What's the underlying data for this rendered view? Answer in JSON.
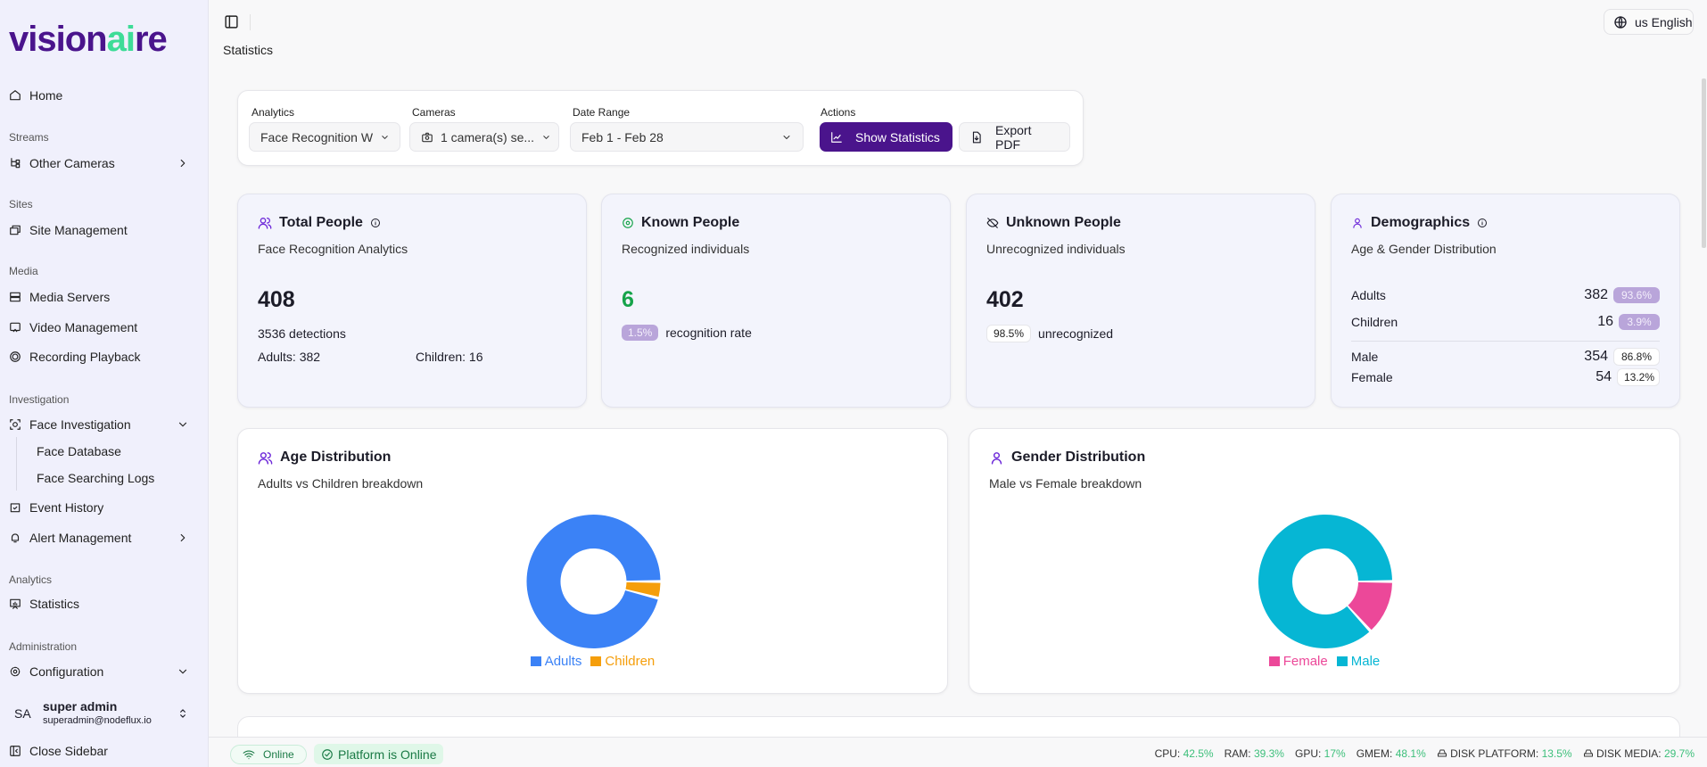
{
  "brand": {
    "logo_text_a": "visi",
    "logo_text_b": "on",
    "logo_text_c": "ai",
    "logo_text_d": "re"
  },
  "sidebar": {
    "home": "Home",
    "sections": {
      "streams": "Streams",
      "sites": "Sites",
      "media": "Media",
      "investigation": "Investigation",
      "analytics": "Analytics",
      "administration": "Administration"
    },
    "items": {
      "other_cameras": "Other Cameras",
      "site_management": "Site Management",
      "media_servers": "Media Servers",
      "video_management": "Video Management",
      "recording_playback": "Recording Playback",
      "face_investigation": "Face Investigation",
      "face_database": "Face Database",
      "face_searching_logs": "Face Searching Logs",
      "event_history": "Event History",
      "alert_management": "Alert Management",
      "statistics": "Statistics",
      "configuration": "Configuration"
    },
    "user": {
      "initials": "SA",
      "name": "super admin",
      "email": "superadmin@nodeflux.io"
    },
    "close": "Close Sidebar"
  },
  "header": {
    "breadcrumb": "Statistics",
    "language": "us English"
  },
  "filters": {
    "analytics_label": "Analytics",
    "analytics_value": "Face Recognition W",
    "cameras_label": "Cameras",
    "cameras_value": "1 camera(s) se...",
    "date_label": "Date Range",
    "date_value": "Feb 1 - Feb 28",
    "actions_label": "Actions",
    "show_statistics": "Show Statistics",
    "export_pdf": "Export PDF"
  },
  "cards": {
    "total": {
      "title": "Total People",
      "subtitle": "Face Recognition Analytics",
      "value": "408",
      "detections": "3536 detections",
      "adults": "Adults: 382",
      "children": "Children: 16"
    },
    "known": {
      "title": "Known People",
      "subtitle": "Recognized individuals",
      "value": "6",
      "rate": "1.5%",
      "rate_label": "recognition rate"
    },
    "unknown": {
      "title": "Unknown People",
      "subtitle": "Unrecognized individuals",
      "value": "402",
      "rate": "98.5%",
      "rate_label": "unrecognized"
    },
    "demographics": {
      "title": "Demographics",
      "subtitle": "Age & Gender Distribution",
      "rows": [
        {
          "label": "Adults",
          "value": "382",
          "pct": "93.6%"
        },
        {
          "label": "Children",
          "value": "16",
          "pct": "3.9%"
        },
        {
          "label": "Male",
          "value": "354",
          "pct": "86.8%"
        },
        {
          "label": "Female",
          "value": "54",
          "pct": "13.2%"
        }
      ]
    }
  },
  "chart_data": [
    {
      "type": "pie",
      "title": "Age Distribution",
      "subtitle": "Adults vs Children breakdown",
      "donut": true,
      "categories": [
        "Adults",
        "Children"
      ],
      "values": [
        382,
        16
      ],
      "colors": [
        "#3b82f6",
        "#f59e0b"
      ],
      "legend": "bottom",
      "legend_order": [
        "Adults",
        "Children"
      ]
    },
    {
      "type": "pie",
      "title": "Gender Distribution",
      "subtitle": "Male vs Female breakdown",
      "donut": true,
      "categories": [
        "Female",
        "Male"
      ],
      "values": [
        54,
        354
      ],
      "colors": [
        "#ec4899",
        "#06b6d4"
      ],
      "legend": "bottom",
      "legend_order": [
        "Female",
        "Male"
      ]
    }
  ],
  "status": {
    "online": "Online",
    "platform": "Platform is Online",
    "metrics": [
      {
        "label": "CPU:",
        "value": "42.5%"
      },
      {
        "label": "RAM:",
        "value": "39.3%"
      },
      {
        "label": "GPU:",
        "value": "17%"
      },
      {
        "label": "GMEM:",
        "value": "48.1%"
      },
      {
        "label": "DISK PLATFORM:",
        "value": "13.5%"
      },
      {
        "label": "DISK MEDIA:",
        "value": "29.7%"
      }
    ]
  },
  "colors": {
    "primary": "#4a148c",
    "accent": "#3ddc97",
    "success": "#16a34a"
  }
}
